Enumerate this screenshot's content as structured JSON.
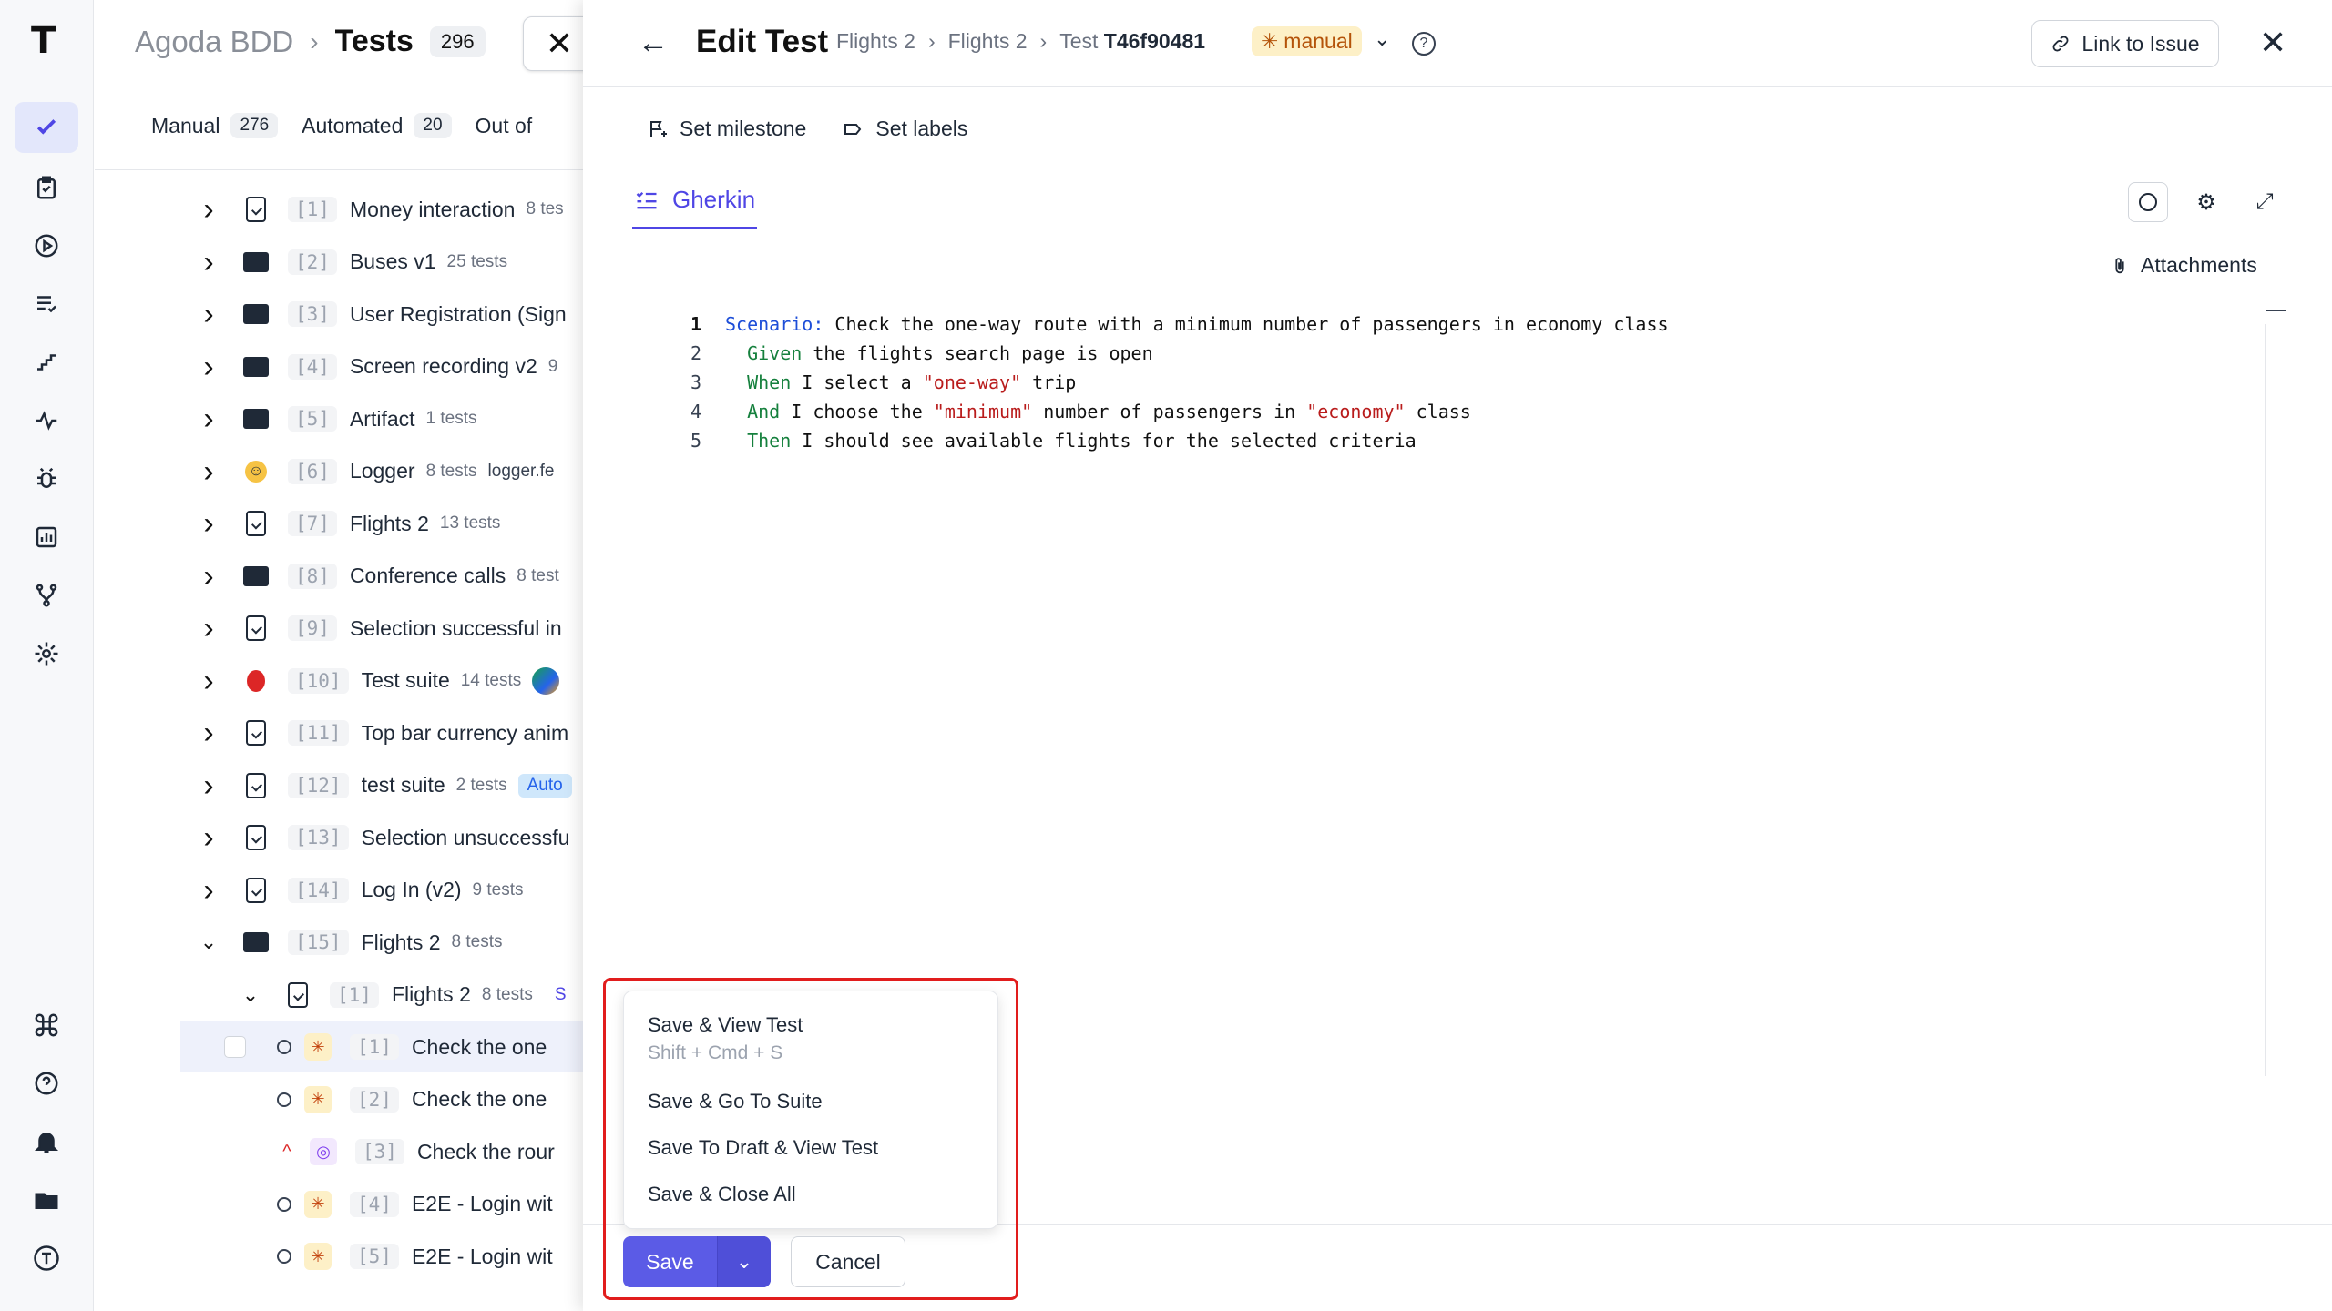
{
  "suites": {
    "project": "Agoda BDD",
    "breadcrumb_sep": "›",
    "title": "Tests",
    "count": "296",
    "close_glyph": "✕",
    "filter_tabs": [
      {
        "label": "Manual",
        "count": "276"
      },
      {
        "label": "Automated",
        "count": "20"
      },
      {
        "label": "Out of",
        "count": ""
      }
    ],
    "rows": [
      {
        "chev": "›",
        "icon": "doc",
        "num": "[1]",
        "label": "Money interaction",
        "sub": "8 tes",
        "extra": ""
      },
      {
        "chev": "›",
        "icon": "folder",
        "num": "[2]",
        "label": "Buses v1",
        "sub": "25 tests",
        "extra": ""
      },
      {
        "chev": "›",
        "icon": "folder",
        "num": "[3]",
        "label": "User Registration (Sign",
        "sub": "",
        "extra": ""
      },
      {
        "chev": "›",
        "icon": "folder",
        "num": "[4]",
        "label": "Screen recording v2",
        "sub": "9",
        "extra": ""
      },
      {
        "chev": "›",
        "icon": "folder",
        "num": "[5]",
        "label": "Artifact",
        "sub": "1 tests",
        "extra": ""
      },
      {
        "chev": "›",
        "icon": "emoji",
        "num": "[6]",
        "label": "Logger",
        "sub": "8 tests",
        "extra": "logger.fe"
      },
      {
        "chev": "›",
        "icon": "doc",
        "num": "[7]",
        "label": "Flights 2",
        "sub": "13 tests",
        "extra": ""
      },
      {
        "chev": "›",
        "icon": "folder",
        "num": "[8]",
        "label": "Conference calls",
        "sub": "8 test",
        "extra": ""
      },
      {
        "chev": "›",
        "icon": "doc",
        "num": "[9]",
        "label": "Selection successful in",
        "sub": "",
        "extra": ""
      },
      {
        "chev": "›",
        "icon": "redbug",
        "num": "[10]",
        "label": "Test suite",
        "sub": "14 tests",
        "extra": ""
      },
      {
        "chev": "›",
        "icon": "doc",
        "num": "[11]",
        "label": "Top bar currency anim",
        "sub": "",
        "extra": ""
      },
      {
        "chev": "›",
        "icon": "doc",
        "num": "[12]",
        "label": "test suite",
        "sub": "2 tests",
        "extra": "Auto"
      },
      {
        "chev": "›",
        "icon": "doc",
        "num": "[13]",
        "label": "Selection unsuccessfu",
        "sub": "",
        "extra": ""
      },
      {
        "chev": "›",
        "icon": "doc",
        "num": "[14]",
        "label": "Log In (v2)",
        "sub": "9 tests",
        "extra": ""
      },
      {
        "chev": "⌄",
        "icon": "folder",
        "num": "[15]",
        "label": "Flights 2",
        "sub": "8 tests",
        "extra": ""
      },
      {
        "chev": "⌄",
        "icon": "doc",
        "num": "[1]",
        "label": "Flights 2",
        "sub": "8 tests",
        "extra": "S"
      },
      {
        "chev": "",
        "icon": "manual",
        "num": "[1]",
        "label": "Check the one",
        "sub": "",
        "extra": ""
      },
      {
        "chev": "",
        "icon": "manual",
        "num": "[2]",
        "label": "Check the one",
        "sub": "",
        "extra": ""
      },
      {
        "chev": "",
        "icon": "auto",
        "num": "[3]",
        "label": "Check the rour",
        "sub": "",
        "extra": ""
      },
      {
        "chev": "",
        "icon": "manual",
        "num": "[4]",
        "label": "E2E - Login wit",
        "sub": "",
        "extra": ""
      },
      {
        "chev": "",
        "icon": "manual",
        "num": "[5]",
        "label": "E2E - Login wit",
        "sub": "",
        "extra": ""
      }
    ]
  },
  "edit": {
    "back_glyph": "←",
    "title": "Edit Test",
    "crumb_1": "Flights 2",
    "crumb_sep": "›",
    "crumb_2": "Flights 2",
    "crumb_3_prefix": "Test",
    "crumb_3_id": "T46f90481",
    "type_badge": "manual",
    "type_badge_icon": "✳",
    "caret_glyph": "⌄",
    "help_glyph": "?",
    "link_issue": "Link to Issue",
    "close_glyph": "✕",
    "set_milestone": "Set milestone",
    "set_labels": "Set labels",
    "tab_gherkin": "Gherkin",
    "attachments": "Attachments",
    "gear_glyph": "⚙",
    "expand_glyph": "⤢",
    "clip_glyph": "⌇"
  },
  "editor": {
    "lines": [
      {
        "no": "1",
        "parts": [
          {
            "t": "Scenario:",
            "c": "kw"
          },
          {
            "t": " Check the one-way route with a minimum number of passengers in economy class",
            "c": ""
          }
        ]
      },
      {
        "no": "2",
        "parts": [
          {
            "t": "  ",
            "c": ""
          },
          {
            "t": "Given",
            "c": "kw2"
          },
          {
            "t": " the flights search page is open",
            "c": ""
          }
        ]
      },
      {
        "no": "3",
        "parts": [
          {
            "t": "  ",
            "c": ""
          },
          {
            "t": "When",
            "c": "kw2"
          },
          {
            "t": " I select a ",
            "c": ""
          },
          {
            "t": "\"one-way\"",
            "c": "str"
          },
          {
            "t": " trip",
            "c": ""
          }
        ]
      },
      {
        "no": "4",
        "parts": [
          {
            "t": "  ",
            "c": ""
          },
          {
            "t": "And",
            "c": "kw2"
          },
          {
            "t": " I choose the ",
            "c": ""
          },
          {
            "t": "\"minimum\"",
            "c": "str"
          },
          {
            "t": " number of passengers in ",
            "c": ""
          },
          {
            "t": "\"economy\"",
            "c": "str"
          },
          {
            "t": " class",
            "c": ""
          }
        ]
      },
      {
        "no": "5",
        "parts": [
          {
            "t": "  ",
            "c": ""
          },
          {
            "t": "Then",
            "c": "kw2"
          },
          {
            "t": " I should see available flights for the selected criteria",
            "c": ""
          }
        ]
      }
    ]
  },
  "save_menu": {
    "items": [
      {
        "label": "Save & View Test",
        "hint": "Shift + Cmd + S"
      },
      {
        "label": "Save & Go To Suite",
        "hint": ""
      },
      {
        "label": "Save To Draft & View Test",
        "hint": ""
      },
      {
        "label": "Save & Close All",
        "hint": ""
      }
    ],
    "save_label": "Save",
    "save_caret": "⌄",
    "cancel_label": "Cancel"
  },
  "rail": {
    "logo": "T"
  },
  "colors": {
    "accent": "#4f46e5",
    "save_button": "#5b5be6",
    "highlight_box": "#e11d1d",
    "manual_badge_bg": "#fdf0c7"
  }
}
